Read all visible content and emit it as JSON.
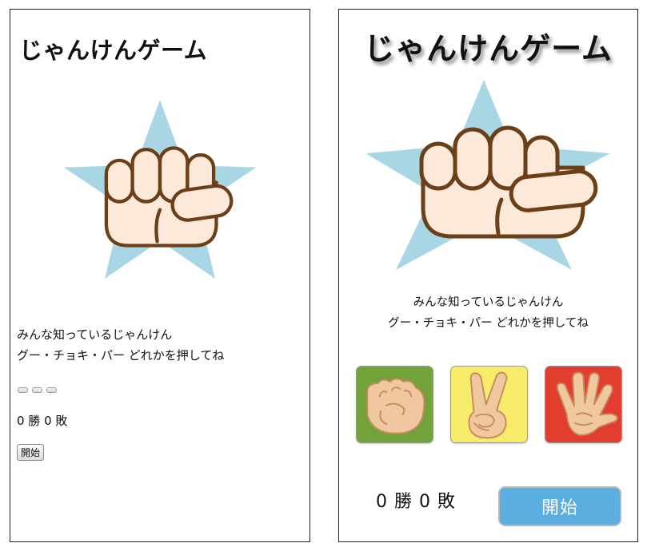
{
  "title": "じゃんけんゲーム",
  "message": {
    "line1": "みんな知っているじゃんけん",
    "line2": "グー・チョキ・パー どれかを押してね"
  },
  "hero_icon": "fist-on-star-icon",
  "hands": [
    {
      "name": "rock",
      "icon": "rock-hand-icon",
      "bg": "#72a33a"
    },
    {
      "name": "scissors",
      "icon": "scissors-hand-icon",
      "bg": "#f7eb6a"
    },
    {
      "name": "paper",
      "icon": "paper-hand-icon",
      "bg": "#e23e30"
    }
  ],
  "score": {
    "text": "0 勝 0 敗",
    "wins": 0,
    "losses": 0
  },
  "start_label": "開始",
  "colors": {
    "star": "#a9d6e5",
    "skin": "#fde9da",
    "outline": "#6b3f17",
    "start_button": "#5aaee0"
  }
}
